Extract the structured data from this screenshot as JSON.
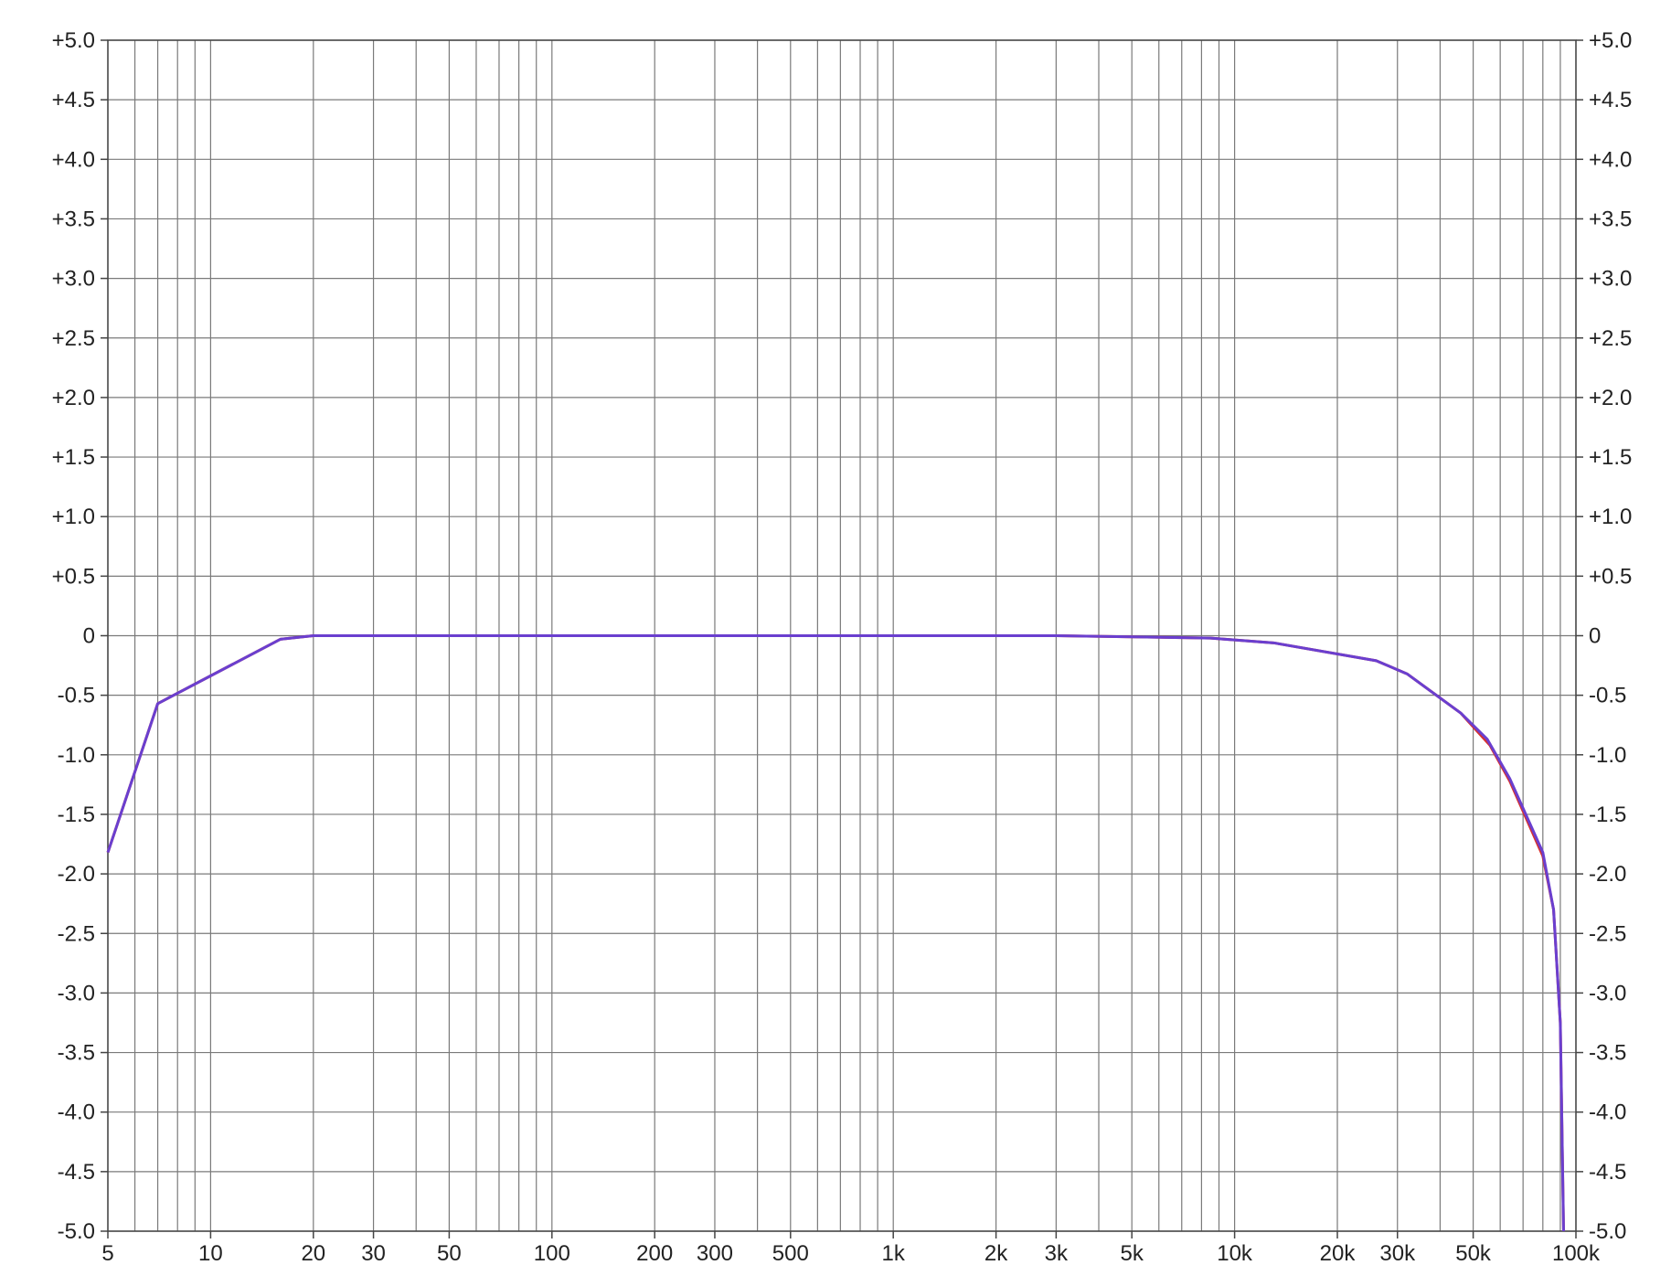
{
  "chart_data": {
    "type": "line",
    "title": "",
    "xlabel": "",
    "ylabel": "",
    "x_scale": "log",
    "xlim": [
      5,
      100000
    ],
    "ylim": [
      -5.0,
      5.0
    ],
    "grid": true,
    "x_tick_labels": [
      {
        "value": 5,
        "label": "5"
      },
      {
        "value": 10,
        "label": "10"
      },
      {
        "value": 20,
        "label": "20"
      },
      {
        "value": 30,
        "label": "30"
      },
      {
        "value": 50,
        "label": "50"
      },
      {
        "value": 100,
        "label": "100"
      },
      {
        "value": 200,
        "label": "200"
      },
      {
        "value": 300,
        "label": "300"
      },
      {
        "value": 500,
        "label": "500"
      },
      {
        "value": 1000,
        "label": "1k"
      },
      {
        "value": 2000,
        "label": "2k"
      },
      {
        "value": 3000,
        "label": "3k"
      },
      {
        "value": 5000,
        "label": "5k"
      },
      {
        "value": 10000,
        "label": "10k"
      },
      {
        "value": 20000,
        "label": "20k"
      },
      {
        "value": 30000,
        "label": "30k"
      },
      {
        "value": 50000,
        "label": "50k"
      },
      {
        "value": 100000,
        "label": "100k"
      }
    ],
    "y_tick_labels": [
      {
        "value": 5.0,
        "label": "+5.0"
      },
      {
        "value": 4.5,
        "label": "+4.5"
      },
      {
        "value": 4.0,
        "label": "+4.0"
      },
      {
        "value": 3.5,
        "label": "+3.5"
      },
      {
        "value": 3.0,
        "label": "+3.0"
      },
      {
        "value": 2.5,
        "label": "+2.5"
      },
      {
        "value": 2.0,
        "label": "+2.0"
      },
      {
        "value": 1.5,
        "label": "+1.5"
      },
      {
        "value": 1.0,
        "label": "+1.0"
      },
      {
        "value": 0.5,
        "label": "+0.5"
      },
      {
        "value": 0.0,
        "label": "0"
      },
      {
        "value": -0.5,
        "label": "-0.5"
      },
      {
        "value": -1.0,
        "label": "-1.0"
      },
      {
        "value": -1.5,
        "label": "-1.5"
      },
      {
        "value": -2.0,
        "label": "-2.0"
      },
      {
        "value": -2.5,
        "label": "-2.5"
      },
      {
        "value": -3.0,
        "label": "-3.0"
      },
      {
        "value": -3.5,
        "label": "-3.5"
      },
      {
        "value": -4.0,
        "label": "-4.0"
      },
      {
        "value": -4.5,
        "label": "-4.5"
      },
      {
        "value": -5.0,
        "label": "-5.0"
      }
    ],
    "series": [
      {
        "color": "#d63030",
        "points": [
          [
            5,
            -1.82
          ],
          [
            7,
            -0.57
          ],
          [
            16,
            -0.03
          ],
          [
            20,
            0.0
          ],
          [
            100,
            0.0
          ],
          [
            1000,
            0.0
          ],
          [
            3000,
            0.0
          ],
          [
            8500,
            -0.02
          ],
          [
            13000,
            -0.06
          ],
          [
            26000,
            -0.21
          ],
          [
            32000,
            -0.32
          ],
          [
            46000,
            -0.65
          ],
          [
            56000,
            -0.92
          ],
          [
            64000,
            -1.22
          ],
          [
            80000,
            -1.85
          ],
          [
            86000,
            -2.3
          ],
          [
            90000,
            -3.25
          ],
          [
            92000,
            -5.0
          ]
        ]
      },
      {
        "color": "#6a3fcf",
        "points": [
          [
            5,
            -1.82
          ],
          [
            7,
            -0.57
          ],
          [
            16,
            -0.03
          ],
          [
            20,
            0.0
          ],
          [
            100,
            0.0
          ],
          [
            1000,
            0.0
          ],
          [
            3000,
            0.0
          ],
          [
            8500,
            -0.02
          ],
          [
            13000,
            -0.06
          ],
          [
            26000,
            -0.21
          ],
          [
            32000,
            -0.32
          ],
          [
            46000,
            -0.65
          ],
          [
            55000,
            -0.87
          ],
          [
            64000,
            -1.2
          ],
          [
            80000,
            -1.82
          ],
          [
            86000,
            -2.3
          ],
          [
            90000,
            -3.25
          ],
          [
            92000,
            -5.0
          ]
        ]
      }
    ]
  }
}
